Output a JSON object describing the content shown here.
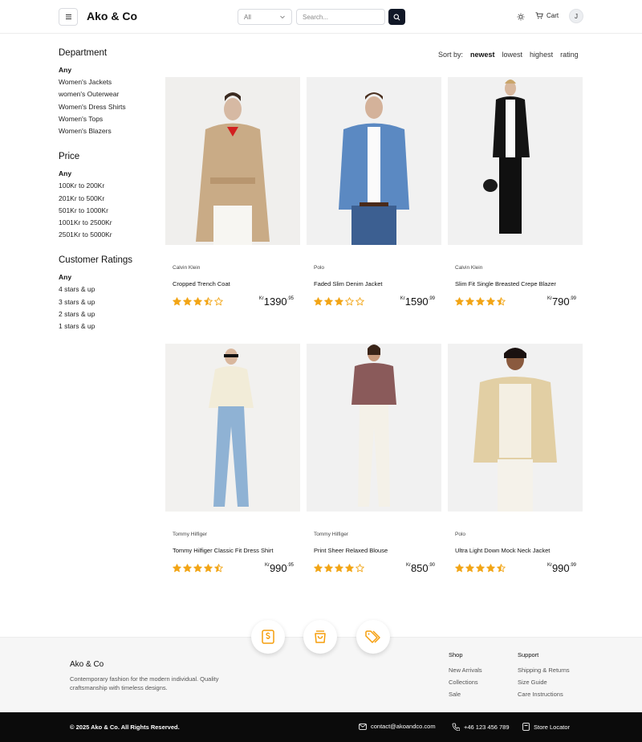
{
  "header": {
    "brand": "Ako & Co",
    "category_select": "All",
    "search_placeholder": "Search...",
    "cart_label": "Cart",
    "avatar_initial": "J"
  },
  "filters": {
    "department": {
      "title": "Department",
      "options": [
        "Any",
        "Women's Jackets",
        "women's Outerwear",
        "Women's Dress Shirts",
        "Women's Tops",
        "Women's Blazers"
      ]
    },
    "price": {
      "title": "Price",
      "options": [
        "Any",
        "100Kr to 200Kr",
        "201Kr to 500Kr",
        "501Kr to 1000Kr",
        "1001Kr to 2500Kr",
        "2501Kr to 5000Kr"
      ]
    },
    "ratings": {
      "title": "Customer Ratings",
      "options": [
        "Any",
        "4 stars & up",
        "3 stars & up",
        "2 stars & up",
        "1 stars & up"
      ]
    }
  },
  "sort": {
    "label": "Sort by:",
    "options": [
      "newest",
      "lowest",
      "highest",
      "rating"
    ],
    "active": "newest"
  },
  "products": [
    {
      "brand": "Calvin Klein",
      "name": "Cropped Trench Coat",
      "currency": "Kr",
      "price_main": "1390",
      "price_cents": ".95",
      "rating": 3.5
    },
    {
      "brand": "Polo",
      "name": "Faded Slim Denim Jacket",
      "currency": "Kr",
      "price_main": "1590",
      "price_cents": ".99",
      "rating": 3
    },
    {
      "brand": "Calvin Klein",
      "name": "Slim Fit Single Breasted Crepe Blazer",
      "currency": "Kr",
      "price_main": "790",
      "price_cents": ".99",
      "rating": 4.5
    },
    {
      "brand": "Tommy Hilfiger",
      "name": "Tommy Hilfiger Classic Fit Dress Shirt",
      "currency": "Kr",
      "price_main": "990",
      "price_cents": ".95",
      "rating": 4.5
    },
    {
      "brand": "Tommy Hilfiger",
      "name": "Print Sheer Relaxed Blouse",
      "currency": "Kr",
      "price_main": "850",
      "price_cents": ".90",
      "rating": 4
    },
    {
      "brand": "Polo",
      "name": "Ultra Light Down Mock Neck Jacket",
      "currency": "Kr",
      "price_main": "990",
      "price_cents": ".99",
      "rating": 4.5
    }
  ],
  "footer": {
    "brand": "Ako & Co",
    "description": "Contemporary fashion for the modern individual. Quality craftsmanship with timeless designs.",
    "shop": {
      "title": "Shop",
      "links": [
        "New Arrivals",
        "Collections",
        "Sale"
      ]
    },
    "support": {
      "title": "Support",
      "links": [
        "Shipping & Returns",
        "Size Guide",
        "Care Instructions"
      ]
    },
    "copyright": "© 2025 Ako & Co. All Rights Reserved.",
    "email": "contact@akoandco.com",
    "phone": "+46 123 456 789",
    "store_locator": "Store Locator"
  },
  "colors": {
    "star": "#f2a516",
    "dark": "#111827"
  }
}
